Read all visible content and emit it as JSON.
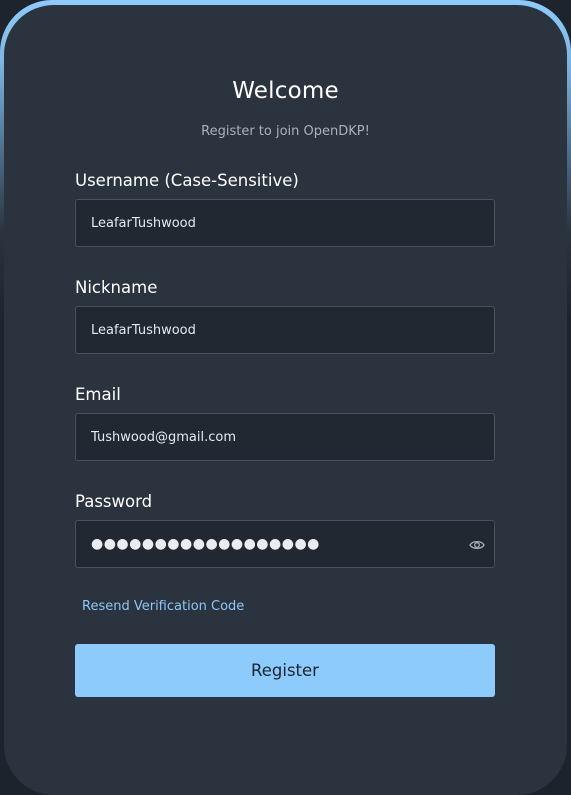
{
  "header": {
    "title": "Welcome",
    "subtitle": "Register to join OpenDKP!"
  },
  "form": {
    "username": {
      "label": "Username (Case-Sensitive)",
      "value": "LeafarTushwood"
    },
    "nickname": {
      "label": "Nickname",
      "value": "LeafarTushwood"
    },
    "email": {
      "label": "Email",
      "value": "Tushwood@gmail.com"
    },
    "password": {
      "label": "Password",
      "masked_value": "●●●●●●●●●●●●●●●●●●",
      "toggle_icon": "eye-icon"
    },
    "resend_link": "Resend Verification Code",
    "register_label": "Register"
  },
  "colors": {
    "accent": "#8dcbfc",
    "card": "#2b333e",
    "input_bg": "#212831",
    "link": "#8ac8f8"
  }
}
